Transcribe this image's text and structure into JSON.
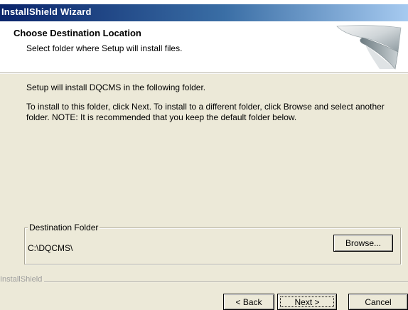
{
  "window": {
    "title": "InstallShield Wizard"
  },
  "header": {
    "title": "Choose Destination Location",
    "subtitle": "Select folder where Setup will install files.",
    "logo_icon": "installer-swirl-graphic"
  },
  "body": {
    "line1": "Setup will install DQCMS in the following folder.",
    "line2": "To install to this folder, click Next. To install to a different folder, click Browse and select another folder. NOTE: It is recommended that you keep the default folder below."
  },
  "destination": {
    "group_label": "Destination Folder",
    "path": "C:\\DQCMS\\",
    "browse_label": "Browse..."
  },
  "footer": {
    "brand": "InstallShield",
    "back_label": "< Back",
    "next_label": "Next >",
    "cancel_label": "Cancel"
  }
}
